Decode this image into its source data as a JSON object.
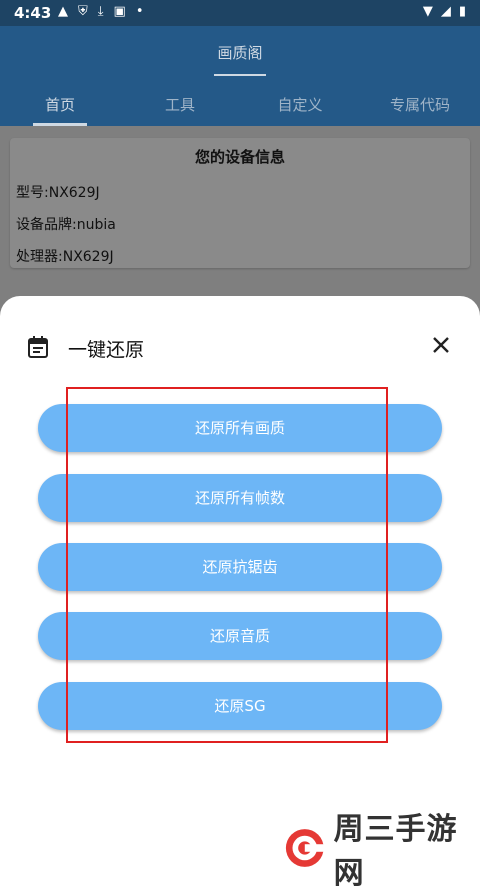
{
  "status": {
    "time": "4:43",
    "left_icons": [
      "warning-icon",
      "shield-icon",
      "download-icon",
      "app-icon",
      "dot-icon"
    ],
    "right_icons": [
      "wifi-icon",
      "signal-icon",
      "battery-icon"
    ]
  },
  "app": {
    "title": "画质阁",
    "tabs": [
      {
        "label": "首页",
        "active": true
      },
      {
        "label": "工具",
        "active": false
      },
      {
        "label": "自定义",
        "active": false
      },
      {
        "label": "专属代码",
        "active": false
      }
    ]
  },
  "device_card": {
    "title": "您的设备信息",
    "model": "型号:NX629J",
    "brand": "设备品牌:nubia",
    "processor": "处理器:NX629J"
  },
  "sheet": {
    "title": "一键还原",
    "buttons": [
      "还原所有画质",
      "还原所有帧数",
      "还原抗锯齿",
      "还原音质",
      "还原SG"
    ]
  },
  "watermark": {
    "text": "周三手游网"
  },
  "colors": {
    "statusbar": "#1e4464",
    "appbar": "#245988",
    "button": "#6db6f6",
    "highlight": "#e02020"
  }
}
